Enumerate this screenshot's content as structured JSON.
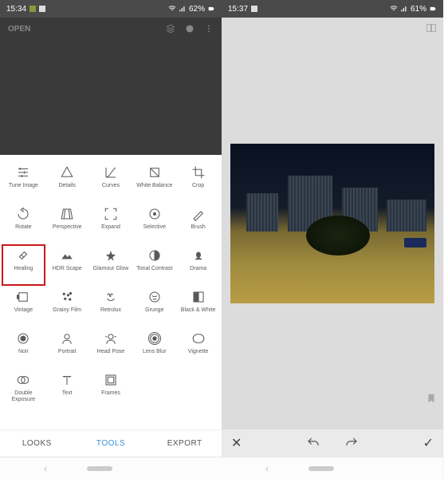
{
  "left": {
    "status": {
      "time": "15:34",
      "battery": "62%"
    },
    "open_label": "OPEN",
    "tools": [
      {
        "id": "tune-image",
        "label": "Tune Image"
      },
      {
        "id": "details",
        "label": "Details"
      },
      {
        "id": "curves",
        "label": "Curves"
      },
      {
        "id": "white-balance",
        "label": "White Balance"
      },
      {
        "id": "crop",
        "label": "Crop"
      },
      {
        "id": "rotate",
        "label": "Rotate"
      },
      {
        "id": "perspective",
        "label": "Perspective"
      },
      {
        "id": "expand",
        "label": "Expand"
      },
      {
        "id": "selective",
        "label": "Selective"
      },
      {
        "id": "brush",
        "label": "Brush"
      },
      {
        "id": "healing",
        "label": "Healing",
        "highlighted": true
      },
      {
        "id": "hdr-scape",
        "label": "HDR Scape"
      },
      {
        "id": "glamour-glow",
        "label": "Glamour Glow"
      },
      {
        "id": "tonal-contrast",
        "label": "Tonal Contrast"
      },
      {
        "id": "drama",
        "label": "Drama"
      },
      {
        "id": "vintage",
        "label": "Vintage"
      },
      {
        "id": "grainy-film",
        "label": "Grainy Film"
      },
      {
        "id": "retrolux",
        "label": "Retrolux"
      },
      {
        "id": "grunge",
        "label": "Grunge"
      },
      {
        "id": "black-white",
        "label": "Black & White"
      },
      {
        "id": "noir",
        "label": "Noir"
      },
      {
        "id": "portrait",
        "label": "Portrait"
      },
      {
        "id": "head-pose",
        "label": "Head Pose"
      },
      {
        "id": "lens-blur",
        "label": "Lens Blur"
      },
      {
        "id": "vignette",
        "label": "Vignette"
      },
      {
        "id": "double-exposure",
        "label": "Double Exposure"
      },
      {
        "id": "text",
        "label": "Text"
      },
      {
        "id": "frames",
        "label": "Frames"
      }
    ],
    "tabs": {
      "looks": "LOOKS",
      "tools": "TOOLS",
      "export": "EXPORT"
    }
  },
  "right": {
    "status": {
      "time": "15:37",
      "battery": "61%"
    }
  }
}
